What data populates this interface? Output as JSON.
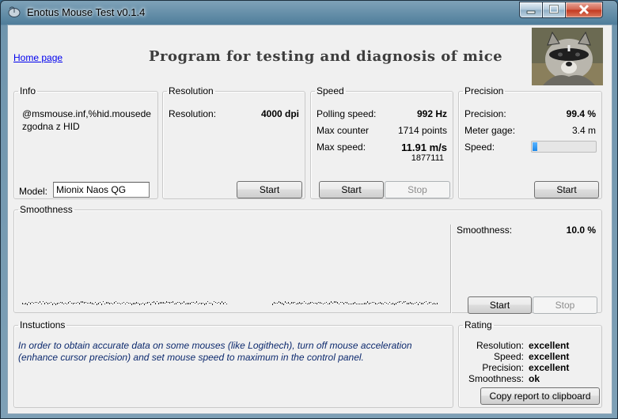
{
  "window": {
    "title": "Enotus Mouse Test v0.1.4",
    "controls": {
      "minimize": "minimize",
      "maximize": "maximize",
      "close": "close"
    }
  },
  "header": {
    "home_link": "Home page",
    "heading": "Program for testing and diagnosis of mice",
    "photo": "raccoon-photo"
  },
  "info": {
    "legend": "Info",
    "device_text_line1": "@msmouse.inf,%hid.mousede",
    "device_text_line2": "zgodna z HID",
    "model_label": "Model:",
    "model_value": "Mionix Naos QG"
  },
  "resolution": {
    "legend": "Resolution",
    "label": "Resolution:",
    "value": "4000 dpi",
    "start": "Start"
  },
  "speed": {
    "legend": "Speed",
    "polling_label": "Polling speed:",
    "polling_value": "992 Hz",
    "max_counter_label": "Max counter",
    "max_counter_value": "1714 points",
    "max_speed_label": "Max  speed:",
    "max_speed_value": "11.91 m/s",
    "max_speed_sub": "1877111",
    "start": "Start",
    "stop": "Stop"
  },
  "precision": {
    "legend": "Precision",
    "precision_label": "Precision:",
    "precision_value": "99.4 %",
    "meter_label": "Meter gage:",
    "meter_value": "3.4 m",
    "speed_label": "Speed:",
    "speed_level": 0.07,
    "start": "Start"
  },
  "smoothness": {
    "legend": "Smoothness",
    "label": "Smoothness:",
    "value": "10.0 %",
    "start": "Start",
    "stop": "Stop"
  },
  "instructions": {
    "legend": "Instuctions",
    "line1": "In order to obtain accurate data on some mouses (like Logithech), turn off mouse acceleration",
    "line2": "(enhance cursor precision) and set mouse speed to maximum in the control panel."
  },
  "rating": {
    "legend": "Rating",
    "rows": [
      {
        "label": "Resolution:",
        "value": "excellent"
      },
      {
        "label": "Speed:",
        "value": "excellent"
      },
      {
        "label": "Precision:",
        "value": "excellent"
      },
      {
        "label": "Smoothness:",
        "value": "ok"
      }
    ],
    "copy_button": "Copy report to clipboard"
  },
  "colors": {
    "link": "#0000ee",
    "instructions_text": "#0d2a6e",
    "progress": "#1c87e8"
  }
}
